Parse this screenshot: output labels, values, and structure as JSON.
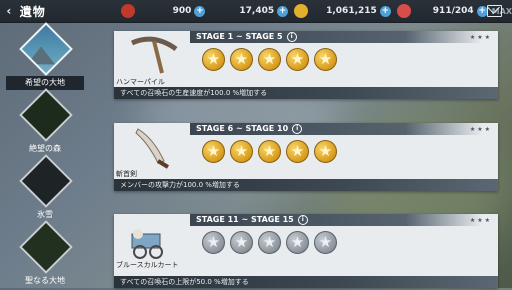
{
  "topbar": {
    "title": "遺物",
    "resources": [
      {
        "icon": "fist-icon",
        "value": "900",
        "color": "#c0392b"
      },
      {
        "icon": "crystal-icon",
        "value": "17,405",
        "color": "#3fa0d8"
      },
      {
        "icon": "gold-coins-icon",
        "value": "1,061,215",
        "color": "#e1b12c"
      },
      {
        "icon": "swords-icon",
        "value": "911/204",
        "color": "#d84c4c"
      }
    ],
    "max_label": "MAX"
  },
  "sidebar": {
    "regions": [
      {
        "label": "希望の大地",
        "active": true
      },
      {
        "label": "絶望の森",
        "active": false
      },
      {
        "label": "氷雪",
        "active": false
      },
      {
        "label": "聖なる大地",
        "active": false
      }
    ]
  },
  "cards": [
    {
      "stage": "STAGE 1 ~ STAGE 5",
      "relic_name": "ハンマーパイル",
      "relic_icon": "pickaxe-icon",
      "stars_filled": 5,
      "stars_total": 5,
      "description": "すべての召喚石の生産速度が100.0 %増加する"
    },
    {
      "stage": "STAGE 6 ~ STAGE 10",
      "relic_name": "斬首剣",
      "relic_icon": "sword-icon",
      "stars_filled": 5,
      "stars_total": 5,
      "description": "メンバーの攻撃力が100.0 %増加する"
    },
    {
      "stage": "STAGE 11 ~ STAGE 15",
      "relic_name": "ブルースカルカート",
      "relic_icon": "cart-icon",
      "stars_filled": 0,
      "stars_total": 5,
      "description": "すべての召喚石の上限が50.0 %増加する"
    }
  ]
}
